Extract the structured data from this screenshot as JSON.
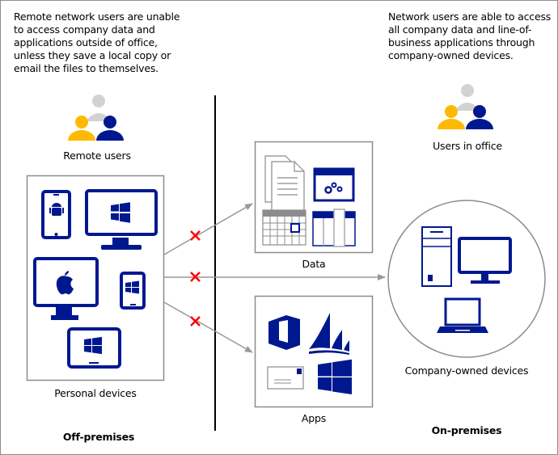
{
  "left_note": {
    "lines": [
      "Remote network users are unable",
      "to access company data and",
      "applications outside of office,",
      "unless they save a local copy or",
      "email the files to themselves."
    ]
  },
  "right_note": {
    "lines": [
      "Network users are able to access",
      "all company data and line-of-",
      "business applications through",
      "company-owned devices."
    ]
  },
  "labels": {
    "remote_users": "Remote users",
    "users_in_office": "Users in office",
    "personal_devices": "Personal devices",
    "data": "Data",
    "apps": "Apps",
    "company_owned_devices": "Company-owned devices",
    "off_premises": "Off-premises",
    "on_premises": "On-premises"
  },
  "colors": {
    "navy": "#00188f",
    "gold": "#ffb900",
    "gray_user": "#d2d2d2",
    "block_x": "#ff0000",
    "line_gray": "#999999",
    "box_border": "#8c8c8c"
  },
  "icons": {
    "personal_devices": [
      "android-phone-icon",
      "windows-monitor-icon",
      "apple-monitor-icon",
      "windows-phone-icon",
      "windows-tablet-icon"
    ],
    "data": [
      "documents-icon",
      "app-window-gears-icon",
      "calendar-icon",
      "table-columns-icon"
    ],
    "apps": [
      "office-icon",
      "dynamics-icon",
      "mail-envelope-icon",
      "windows-logo-icon"
    ],
    "company_devices": [
      "desktop-tower-icon",
      "monitor-icon",
      "laptop-icon"
    ]
  },
  "connections": [
    {
      "from": "personal-devices",
      "to": "data",
      "blocked": true
    },
    {
      "from": "personal-devices",
      "to": "company-owned-devices",
      "blocked": true
    },
    {
      "from": "personal-devices",
      "to": "apps",
      "blocked": true
    }
  ]
}
